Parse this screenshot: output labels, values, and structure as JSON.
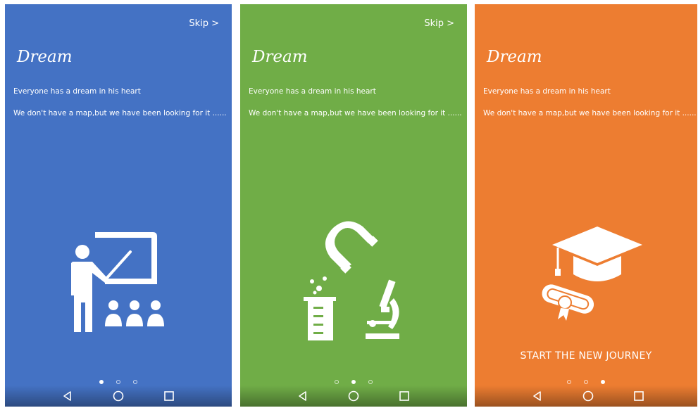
{
  "screens": [
    {
      "skip_label": "Skip >",
      "title": "Dream",
      "line1": "Everyone has a dream in his heart",
      "line2": "We don't have a map,but we have been looking for it ......",
      "illustration": "teacher-classroom-icon",
      "color": "#4472c4",
      "active_page": 1
    },
    {
      "skip_label": "Skip >",
      "title": "Dream",
      "line1": "Everyone has a dream in his heart",
      "line2": "We don't have a map,but we have been looking for it ......",
      "illustration": "science-lab-icon",
      "color": "#70ad47",
      "active_page": 2
    },
    {
      "title": "Dream",
      "line1": "Everyone has a dream in his heart",
      "line2": "We don't have a map,but we have been looking for it ......",
      "illustration": "graduation-cap-diploma-icon",
      "start_label": "START THE NEW JOURNEY",
      "color": "#ed7d31",
      "active_page": 3
    }
  ],
  "navbar": {
    "icons": [
      "back-triangle-icon",
      "home-circle-icon",
      "recent-square-icon"
    ]
  }
}
